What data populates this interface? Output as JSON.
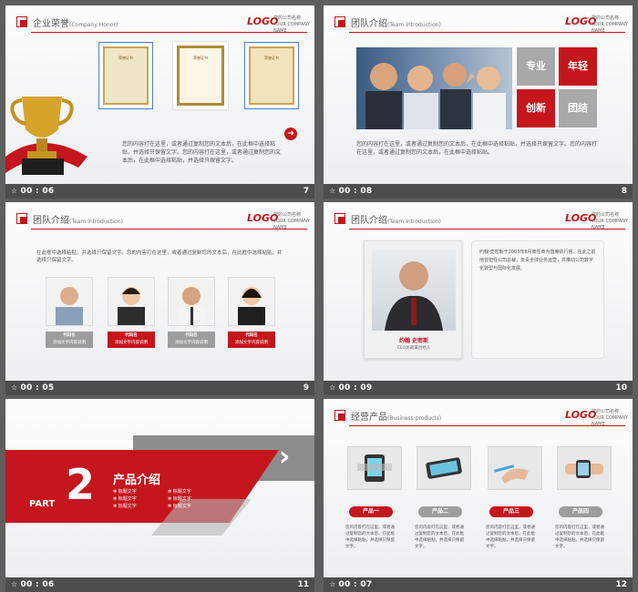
{
  "logo": {
    "text": "LOGO",
    "company": "您的公司名称",
    "company_en": "YOUR COMPANY NAME"
  },
  "slides": [
    {
      "title": "企业荣誉",
      "subtitle": "(Company   Honor)",
      "time": "00 : 06",
      "number": "7",
      "certs": [
        "荣誉证书",
        "荣誉证书",
        "荣誉证书"
      ],
      "text": "您的内容打在这里，或者通过复制您的文本后，在此框中选择粘贴，并选择只保留文字。您的内容打在这里，或者通过复制您的文本后，在此框中选择粘贴，并选择只保留文字。"
    },
    {
      "title": "团队介绍",
      "subtitle": "(Team Introduction)",
      "time": "00 : 08",
      "number": "8",
      "tags": [
        "专业",
        "年轻",
        "创新",
        "团结"
      ],
      "text": "您的内容打在这里，或者通过复制您的文本后，在此框中选择粘贴，并选择只保留文字。您的内容打在这里，或者通过复制您的文本后，在此框中选择粘贴。"
    },
    {
      "title": "团队介绍",
      "subtitle": "(Team Introduction)",
      "time": "00 : 05",
      "number": "9",
      "text": "在此框中选择粘贴，并选择只保留文字。您的内容打在这里，或者通过复制您的文本后，在此框中选择粘贴，并选择只保留文字。",
      "members": [
        {
          "name": "代码名",
          "desc": "添加文字内容说明"
        },
        {
          "name": "代码名",
          "desc": "添加文字内容说明"
        },
        {
          "name": "代码名",
          "desc": "添加文字内容说明"
        },
        {
          "name": "代码名",
          "desc": "添加文字内容说明"
        }
      ]
    },
    {
      "title": "团队介绍",
      "subtitle": "(Team Introduction)",
      "time": "00 : 09",
      "number": "10",
      "person": "约翰 史密斯",
      "person_role": "CEO总裁兼创始人",
      "text": "约翰·史密斯于2003年8月被任命为首席执行官。在此之前他曾担任公司总裁，负责全球业务运营，并推动公司数字化转型与国际化发展。"
    },
    {
      "part": "PART",
      "part_num": "2",
      "section_title": "产品介绍",
      "bullets": [
        "标题文字",
        "标题文字",
        "标题文字",
        "标题文字",
        "标题文字",
        "标题文字"
      ],
      "time": "00 : 06",
      "number": "11"
    },
    {
      "title": "经营产品",
      "subtitle": "(Business    products)",
      "time": "00 : 07",
      "number": "12",
      "products": [
        {
          "name": "产品一",
          "desc": "您的内容打在这里，或者通过复制您的文本后，在此框中选择粘贴，并选择只保留文字。"
        },
        {
          "name": "产品二",
          "desc": "您的内容打在这里，或者通过复制您的文本后，在此框中选择粘贴，并选择只保留文字。"
        },
        {
          "name": "产品三",
          "desc": "您的内容打在这里，或者通过复制您的文本后，在此框中选择粘贴，并选择只保留文字。"
        },
        {
          "name": "产品四",
          "desc": "您的内容打在这里，或者通过复制您的文本后，在此框中选择粘贴，并选择只保留文字。"
        }
      ]
    }
  ]
}
